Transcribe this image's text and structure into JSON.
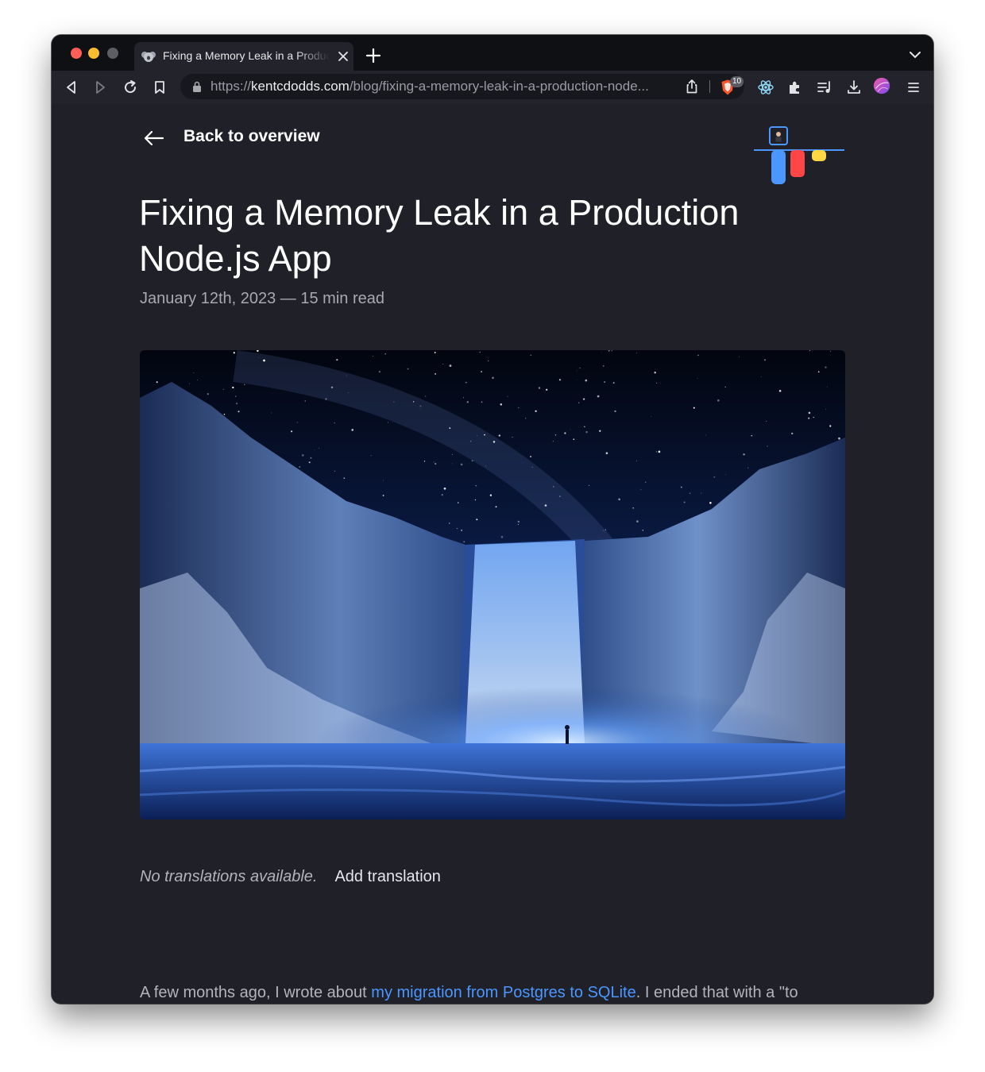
{
  "browser": {
    "tab_title": "Fixing a Memory Leak in a Production Node.js App",
    "url_scheme": "https://",
    "url_host": "kentcdodds.com",
    "url_path": "/blog/fixing-a-memory-leak-in-a-production-node...",
    "brave_shield_count": "10",
    "icons": [
      "back-icon",
      "forward-icon",
      "reload-icon",
      "bookmark-icon",
      "lock-icon",
      "share-icon",
      "brave-shields-icon",
      "react-devtools-icon",
      "extensions-icon",
      "reading-list-icon",
      "downloads-icon",
      "profile-avatar",
      "menu-icon"
    ]
  },
  "article": {
    "back_label": "Back to overview",
    "title": "Fixing a Memory Leak in a Production Node.js App",
    "meta": "January 12th, 2023 — 15 min read",
    "no_translations": "No translations available.",
    "add_translation": "Add translation",
    "intro_before": "A few months ago, I wrote about ",
    "intro_link": "my migration from Postgres to SQLite",
    "intro_after": ". I ended that with a \"to"
  },
  "colors": {
    "page_bg": "#1f2028",
    "link": "#4b96ff",
    "logo_blue": "#4b96ff",
    "logo_red": "#ff4545",
    "logo_yellow": "#ffd644"
  }
}
